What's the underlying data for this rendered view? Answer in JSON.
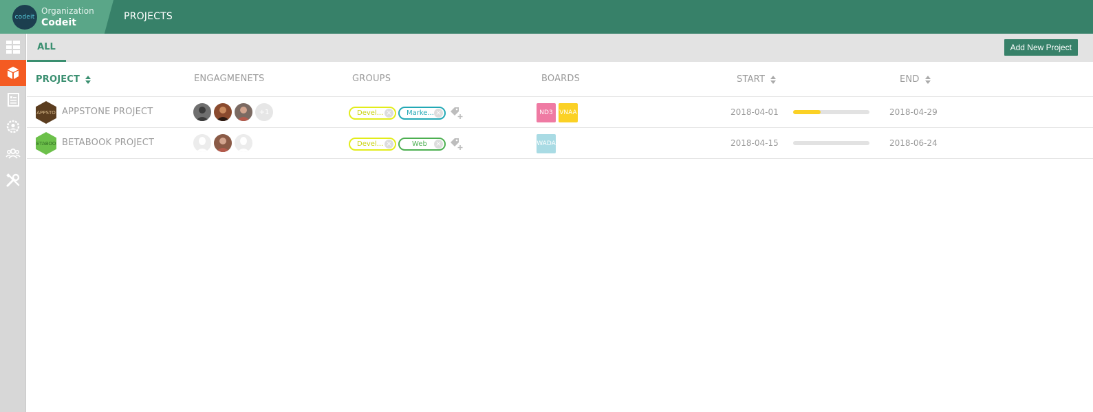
{
  "header": {
    "org_logo_text": "codeit",
    "org_label": "Organization",
    "org_name": "Codeit",
    "page_title": "PROJECTS"
  },
  "sidebar": {
    "items": [
      {
        "icon": "dashboard-grid-icon",
        "active": false
      },
      {
        "icon": "cube-icon",
        "active": true
      },
      {
        "icon": "document-list-icon",
        "active": false
      },
      {
        "icon": "settings-person-icon",
        "active": false
      },
      {
        "icon": "users-icon",
        "active": false
      },
      {
        "icon": "tools-icon",
        "active": false
      }
    ]
  },
  "tabs": {
    "all_label": "ALL",
    "add_button_label": "Add New Project"
  },
  "table": {
    "columns": {
      "project": "PROJECT",
      "engagements": "ENGAGMENETS",
      "groups": "GROUPS",
      "boards": "BOARDS",
      "start": "START",
      "end": "END"
    },
    "rows": [
      {
        "icon_text": "APPSTO",
        "icon_color": "#5b3d1f",
        "name": "APPSTONE PROJECT",
        "avatars": [
          "#6f6f6f",
          "#8a4a2e",
          "#7b6a62"
        ],
        "more_count": "+1",
        "groups": [
          {
            "label": "Devel...",
            "color": "#e2ec1a",
            "text_color": "#c9d30f"
          },
          {
            "label": "Marke...",
            "color": "#22a8b5",
            "text_color": "#22a8b5"
          }
        ],
        "boards": [
          {
            "label": "ND3",
            "color": "#ef7aa3"
          },
          {
            "label": "VNAA",
            "color": "#fbd125"
          }
        ],
        "start": "2018-04-01",
        "progress": 0.36,
        "end": "2018-04-29"
      },
      {
        "icon_text": "BETABOOK",
        "icon_color": "#6cc04a",
        "name": "BETABOOK PROJECT",
        "avatars": [
          "placeholder",
          "#8a5a46",
          "placeholder"
        ],
        "more_count": "",
        "groups": [
          {
            "label": "Devel...",
            "color": "#e2ec1a",
            "text_color": "#c9d30f"
          },
          {
            "label": "Web",
            "color": "#4caf50",
            "text_color": "#4caf50"
          }
        ],
        "boards": [
          {
            "label": "WADA",
            "color": "#a9dbe4"
          }
        ],
        "start": "2018-04-15",
        "progress": 0,
        "end": "2018-06-24"
      }
    ]
  },
  "colors": {
    "header_bg": "#378169",
    "org_bg": "#5aa688",
    "accent": "#3a8f70",
    "sidebar_active": "#f45b22"
  }
}
